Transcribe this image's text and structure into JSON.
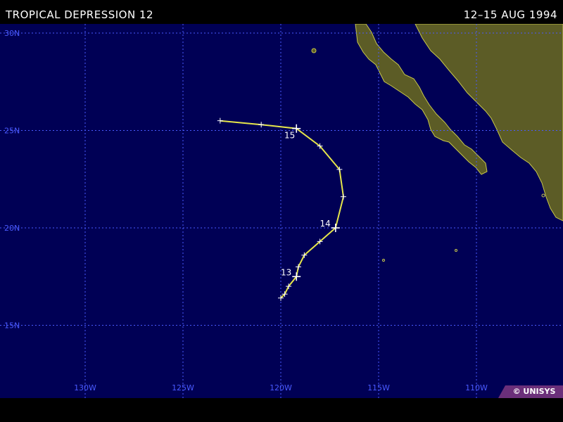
{
  "title": "TROPICAL DEPRESSION 12",
  "dates": "12–15 AUG 1994",
  "credit": "© UNISYS",
  "colors": {
    "ocean": "#000055",
    "land": "#5c5c26",
    "coast": "#c8c84a",
    "grid": "#4a5aff",
    "track": "#e6e64a",
    "label": "#ffffff"
  },
  "grid": {
    "lat_labels": [
      "30N",
      "25N",
      "20N",
      "15N"
    ],
    "lon_labels": [
      "130W",
      "125W",
      "120W",
      "115W",
      "110W"
    ]
  },
  "track": {
    "points": [
      {
        "lat": 16.4,
        "lon": -120.0
      },
      {
        "lat": 16.6,
        "lon": -119.8
      },
      {
        "lat": 17.0,
        "lon": -119.6
      },
      {
        "lat": 17.5,
        "lon": -119.2,
        "label": "13"
      },
      {
        "lat": 18.0,
        "lon": -119.1
      },
      {
        "lat": 18.6,
        "lon": -118.8
      },
      {
        "lat": 19.3,
        "lon": -118.0
      },
      {
        "lat": 20.0,
        "lon": -117.2,
        "label": "14"
      },
      {
        "lat": 21.6,
        "lon": -116.8
      },
      {
        "lat": 23.0,
        "lon": -117.0
      },
      {
        "lat": 24.2,
        "lon": -118.0
      },
      {
        "lat": 25.1,
        "lon": -119.2,
        "label": "15"
      },
      {
        "lat": 25.3,
        "lon": -121.0
      },
      {
        "lat": 25.5,
        "lon": -123.1
      }
    ]
  }
}
